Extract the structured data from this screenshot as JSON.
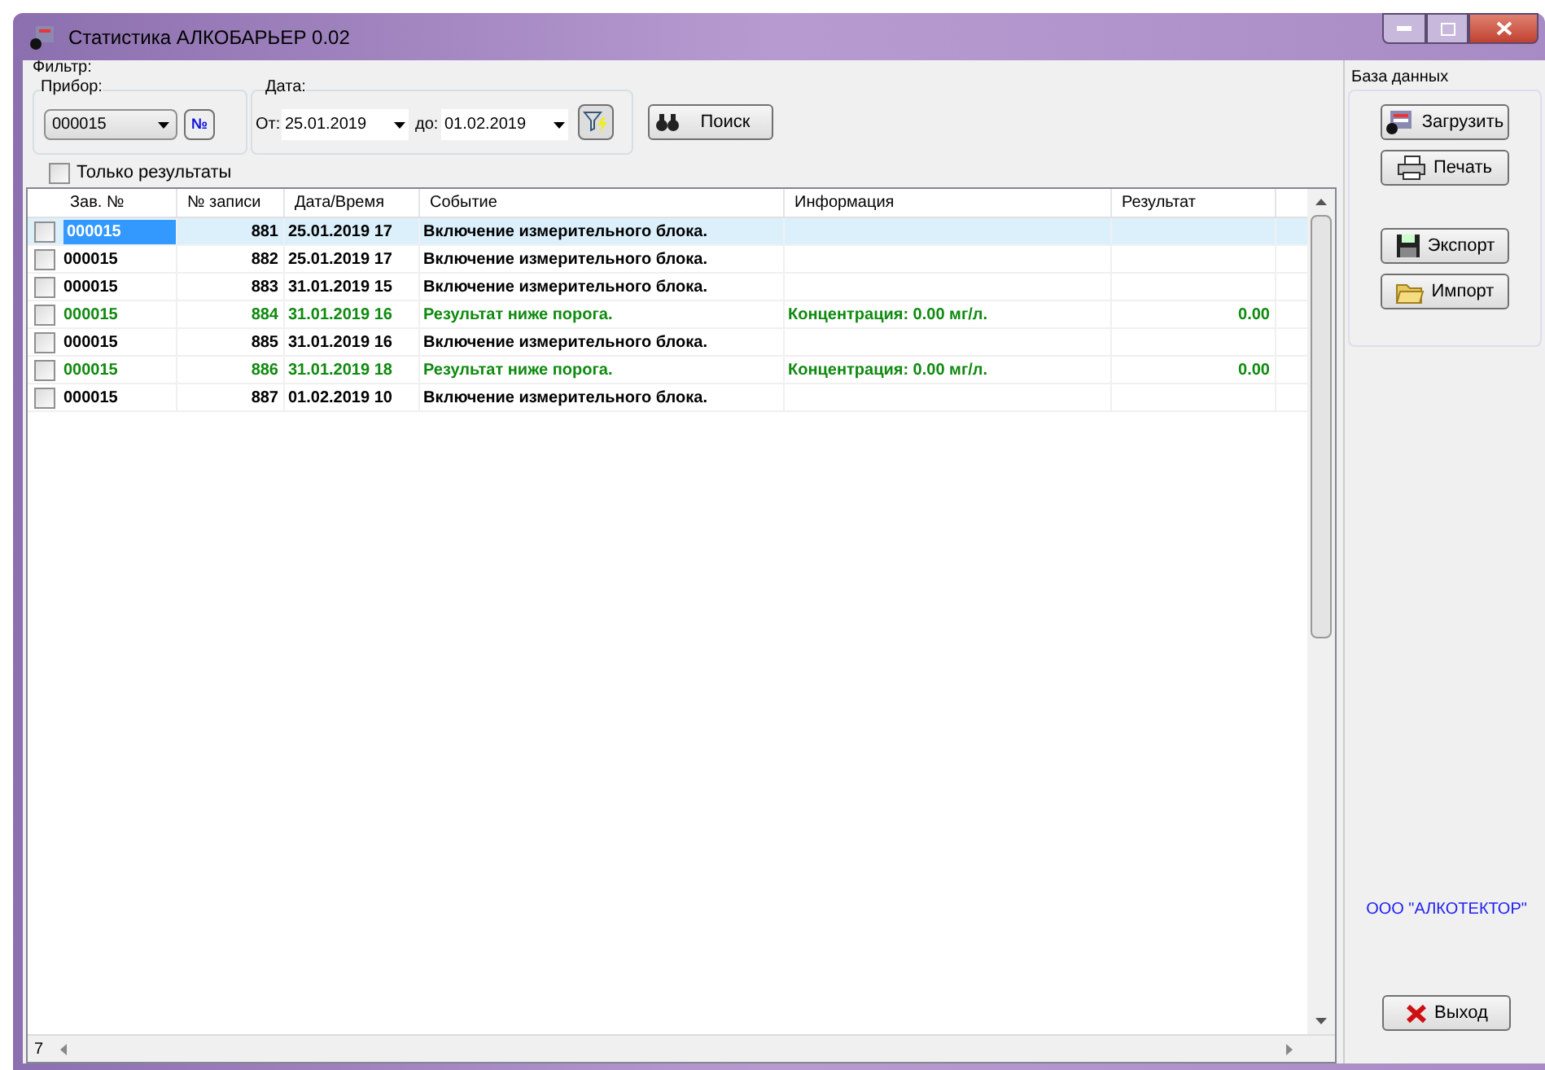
{
  "window": {
    "title": "Статистика АЛКОБАРЬЕР 0.02"
  },
  "filter": {
    "title": "Фильтр:",
    "device_label": "Прибор:",
    "device_value": "000015",
    "number_button": "№",
    "date_label": "Дата:",
    "from_label": "От:",
    "from_value": "25.01.2019",
    "to_label": "до:",
    "to_value": "01.02.2019",
    "search_button": "Поиск",
    "only_results": {
      "label": "Только результаты",
      "checked": false
    }
  },
  "table": {
    "columns": [
      "Зав. №",
      "№ записи",
      "Дата/Время",
      "Событие",
      "Информация",
      "Результат"
    ],
    "rows": [
      {
        "selected": true,
        "checked": false,
        "kind": "event",
        "cells": [
          "000015",
          "881",
          "25.01.2019 17",
          "Включение измерительного блока.",
          "",
          ""
        ]
      },
      {
        "selected": false,
        "checked": false,
        "kind": "event",
        "cells": [
          "000015",
          "882",
          "25.01.2019 17",
          "Включение измерительного блока.",
          "",
          ""
        ]
      },
      {
        "selected": false,
        "checked": false,
        "kind": "event",
        "cells": [
          "000015",
          "883",
          "31.01.2019 15",
          "Включение измерительного блока.",
          "",
          ""
        ]
      },
      {
        "selected": false,
        "checked": false,
        "kind": "result",
        "cells": [
          "000015",
          "884",
          "31.01.2019 16",
          "Результат ниже порога.",
          "Концентрация: 0.00 мг/л.",
          "0.00"
        ]
      },
      {
        "selected": false,
        "checked": false,
        "kind": "event",
        "cells": [
          "000015",
          "885",
          "31.01.2019 16",
          "Включение измерительного блока.",
          "",
          ""
        ]
      },
      {
        "selected": false,
        "checked": false,
        "kind": "result",
        "cells": [
          "000015",
          "886",
          "31.01.2019 18",
          "Результат ниже порога.",
          "Концентрация: 0.00 мг/л.",
          "0.00"
        ]
      },
      {
        "selected": false,
        "checked": false,
        "kind": "event",
        "cells": [
          "000015",
          "887",
          "01.02.2019 10",
          "Включение измерительного блока.",
          "",
          ""
        ]
      }
    ]
  },
  "status_bar": {
    "count": "7"
  },
  "database": {
    "title": "База данных",
    "buttons": [
      {
        "kind": "load",
        "label": "Загрузить"
      },
      {
        "kind": "print",
        "label": "Печать"
      },
      {
        "kind": "export",
        "label": "Экспорт"
      },
      {
        "kind": "import",
        "label": "Импорт"
      }
    ]
  },
  "company": "ООО \"АЛКОТЕКТОР\"",
  "exit_button": "Выход"
}
